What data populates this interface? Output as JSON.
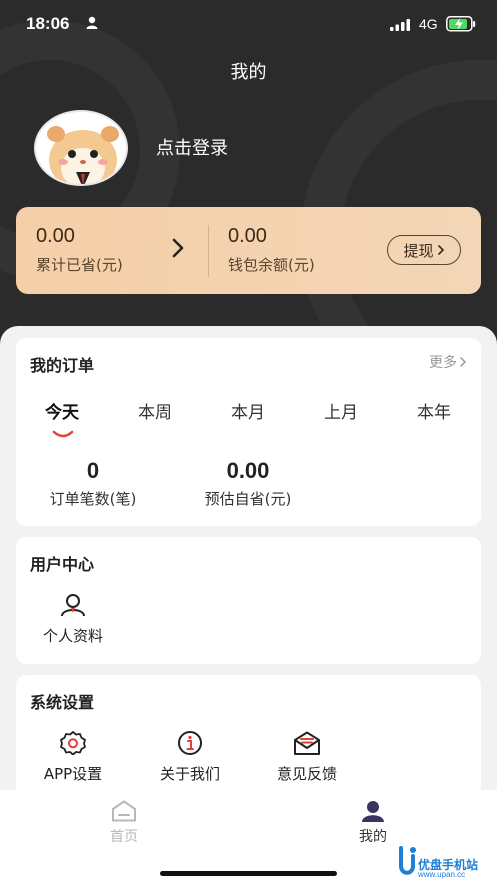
{
  "status_bar": {
    "time": "18:06",
    "network": "4G"
  },
  "header": {
    "title": "我的",
    "login_text": "点击登录"
  },
  "savings": {
    "saved_value": "0.00",
    "saved_label": "累计已省(元)",
    "wallet_value": "0.00",
    "wallet_label": "钱包余额(元)",
    "withdraw_label": "提现"
  },
  "orders": {
    "title": "我的订单",
    "more_label": "更多",
    "tabs": [
      "今天",
      "本周",
      "本月",
      "上月",
      "本年"
    ],
    "active_tab": "今天",
    "order_count_value": "0",
    "order_count_label": "订单笔数(笔)",
    "estimated_savings_value": "0.00",
    "estimated_savings_label": "预估自省(元)"
  },
  "user_center": {
    "title": "用户中心",
    "items": [
      {
        "label": "个人资料",
        "icon": "profile-icon"
      }
    ]
  },
  "system_settings": {
    "title": "系统设置",
    "items": [
      {
        "label": "APP设置",
        "icon": "settings-gear-icon"
      },
      {
        "label": "关于我们",
        "icon": "info-icon"
      },
      {
        "label": "意见反馈",
        "icon": "feedback-mail-icon"
      }
    ]
  },
  "tab_bar": {
    "items": [
      {
        "label": "首页",
        "icon": "home-icon",
        "active": false
      },
      {
        "label": "我的",
        "icon": "user-icon",
        "active": true
      }
    ]
  },
  "watermark": {
    "title": "优盘手机站",
    "url": "www.upan.cc"
  },
  "colors": {
    "header_bg": "#2b2b2b",
    "card_gold": "#f5cfa8",
    "accent_red": "#e0423a",
    "watermark_blue": "#1d7fd6"
  }
}
